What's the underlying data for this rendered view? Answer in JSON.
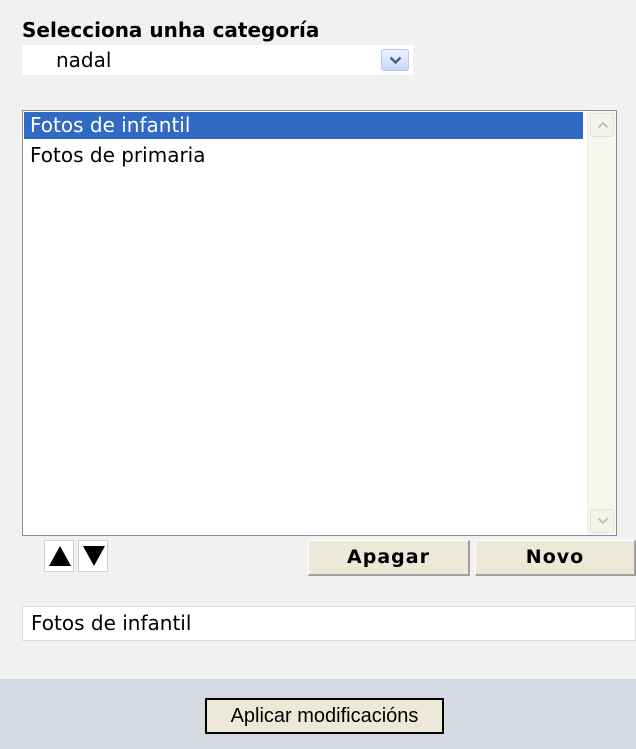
{
  "category": {
    "label": "Selecciona unha categoría",
    "selected_value": "nadal"
  },
  "list": {
    "items": [
      {
        "label": "Fotos de infantil",
        "selected": true
      },
      {
        "label": "Fotos de primaria",
        "selected": false
      }
    ]
  },
  "controls": {
    "move_up_icon": "triangle-up-icon",
    "move_down_icon": "triangle-down-icon",
    "delete_label": "Apagar",
    "new_label": "Novo"
  },
  "name_field": {
    "value": "Fotos de infantil"
  },
  "footer": {
    "apply_label": "Aplicar modificacións"
  },
  "colors": {
    "selection": "#316ac5",
    "footer_band": "#d5dae3",
    "button_face": "#ece9d8"
  }
}
